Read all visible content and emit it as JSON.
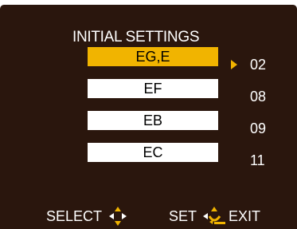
{
  "header": {
    "title": "INITIAL SETTINGS"
  },
  "menu": {
    "items": [
      {
        "label": "EG,E",
        "value": "02",
        "selected": true
      },
      {
        "label": "EF",
        "value": "08",
        "selected": false
      },
      {
        "label": "EB",
        "value": "09",
        "selected": false
      },
      {
        "label": "EC",
        "value": "11",
        "selected": false
      }
    ]
  },
  "footer": {
    "select_label": "SELECT",
    "set_label": "SET",
    "exit_label": "EXIT"
  },
  "colors": {
    "background": "#2a160d",
    "highlight": "#f1b400",
    "item": "#ffffff"
  },
  "icons": {
    "select": "four-way-arrows-icon",
    "set_exit": "three-way-arrows-icon"
  }
}
